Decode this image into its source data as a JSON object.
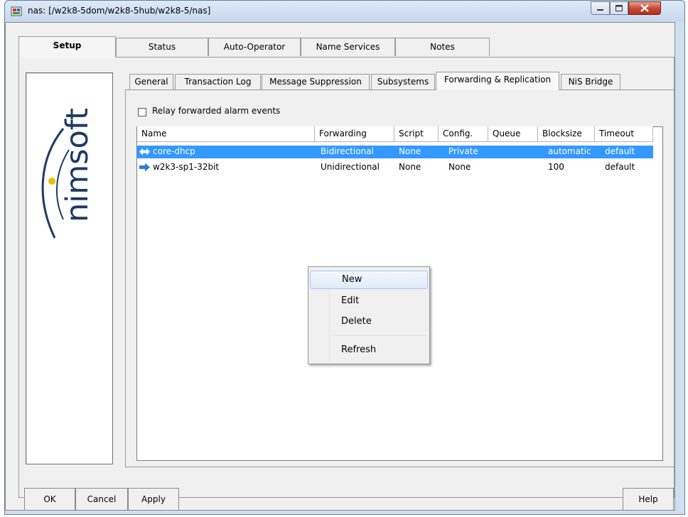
{
  "window": {
    "title": "nas: [/w2k8-5dom/w2k8-5hub/w2k8-5/nas]"
  },
  "outer_tabs": [
    "Setup",
    "Status",
    "Auto-Operator",
    "Name Services",
    "Notes"
  ],
  "logo_text": "nimsoft",
  "inner_tabs": [
    "General",
    "Transaction Log",
    "Message Suppression",
    "Subsystems",
    "Forwarding & Replication",
    "NiS Bridge"
  ],
  "relay_checkbox": {
    "label": "Relay forwarded alarm events",
    "checked": false
  },
  "table": {
    "columns": [
      "Name",
      "Forwarding",
      "Script",
      "Config.",
      "Queue",
      "Blocksize",
      "Timeout"
    ],
    "rows": [
      {
        "icon": "bidirectional-arrow-icon",
        "name": "core-dhcp",
        "forwarding": "Bidirectional",
        "script": "None",
        "config": "Private",
        "queue": "",
        "blocksize": "automatic",
        "timeout": "default",
        "selected": true
      },
      {
        "icon": "right-arrow-icon",
        "name": "w2k3-sp1-32bit",
        "forwarding": "Unidirectional",
        "script": "None",
        "config": "None",
        "queue": "",
        "blocksize": "100",
        "timeout": "default",
        "selected": false
      }
    ]
  },
  "context_menu": {
    "items": [
      "New",
      "Edit",
      "Delete",
      "Refresh"
    ],
    "highlighted": "New"
  },
  "buttons": {
    "ok": "OK",
    "cancel": "Cancel",
    "apply": "Apply",
    "help": "Help"
  },
  "colors": {
    "selection": "#3399ff",
    "icon_blue": "#2a7fd4",
    "close_red": "#c94a33"
  }
}
